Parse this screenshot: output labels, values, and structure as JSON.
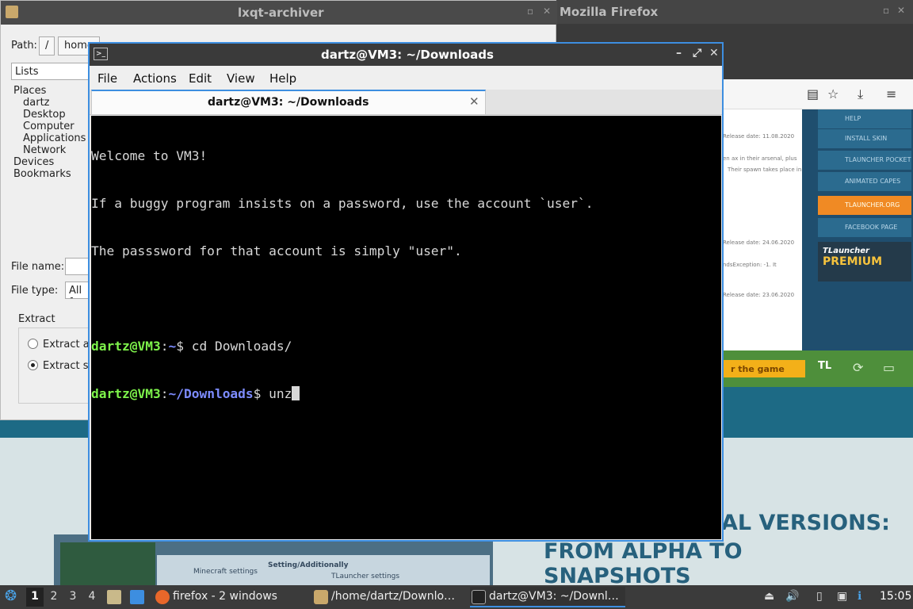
{
  "firefox_window": {
    "title": "Mozilla Firefox",
    "sidebar_items": [
      "HELP",
      "INSTALL SKIN",
      "TLAUNCHER POCKET",
      "ANIMATED CAPES",
      "TLAUNCHER.ORG",
      "FACEBOOK PAGE"
    ],
    "premium_small": "TLauncher",
    "premium_big": "PREMIUM",
    "release_1": "Release date: 11.08.2020",
    "release_2": "Release date: 24.06.2020",
    "release_3": "Release date: 23.06.2020",
    "snippet_1": "en ax in their arsenal, plus",
    "snippet_2": "Their spawn takes place in",
    "snippet_3": "ndsException: -1. It",
    "cta": "r the game",
    "promo_line1": "AL VERSIONS:",
    "promo_line2": "FROM ALPHA TO SNAPSHOTS",
    "shot_label_1": "Minecraft settings",
    "shot_label_2": "Setting/Additionally",
    "shot_label_3": "TLauncher settings"
  },
  "archiver_window": {
    "title": "lxqt-archiver",
    "path_label": "Path:",
    "path_crumbs": [
      "/",
      "home"
    ],
    "places_combo": "Lists",
    "tree": {
      "places": "Places",
      "place_items": [
        "dartz",
        "Desktop",
        "Computer",
        "Applications",
        "Network"
      ],
      "devices": "Devices",
      "bookmarks": "Bookmarks"
    },
    "file_name_label": "File name:",
    "file_type_label": "File type:",
    "file_type_value": "All f",
    "extract_label": "Extract",
    "radio_all": "Extract al",
    "radio_selected": "Extract se"
  },
  "terminal_window": {
    "title": "dartz@VM3: ~/Downloads",
    "menu": [
      "File",
      "Actions",
      "Edit",
      "View",
      "Help"
    ],
    "tab_label": "dartz@VM3: ~/Downloads",
    "lines": {
      "l1": "Welcome to VM3!",
      "l2": "If a buggy program insists on a password, use the account `user`.",
      "l3": "The passsword for that account is simply \"user\".",
      "p1_user": "dartz@VM3",
      "p1_colon": ":",
      "p1_path": "~",
      "p1_cmd": "$ cd Downloads/",
      "p2_user": "dartz@VM3",
      "p2_colon": ":",
      "p2_path": "~/Downloads",
      "p2_cmd": "$ unz"
    }
  },
  "taskbar": {
    "desktops": [
      "1",
      "2",
      "3",
      "4"
    ],
    "tasks": {
      "firefox": "firefox - 2 windows",
      "archiver": "/home/dartz/Downlo…",
      "terminal": "dartz@VM3: ~/Downl…"
    },
    "clock": "15:05"
  },
  "colors": {
    "accent": "#3d8ee0",
    "prompt_user": "#7ef34b",
    "prompt_path": "#7d8cff",
    "terminal_bg": "#000000"
  }
}
